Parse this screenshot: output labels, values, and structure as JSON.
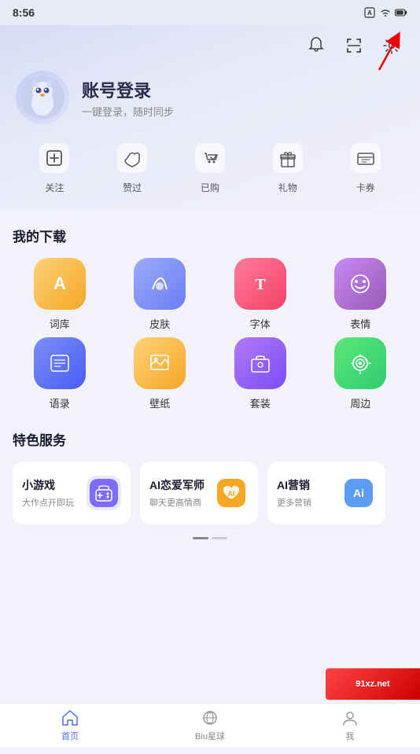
{
  "statusBar": {
    "time": "8:56",
    "icons": [
      "A-icon",
      "wifi-icon",
      "battery-icon"
    ]
  },
  "header": {
    "icons": {
      "bell": "通知",
      "scan": "扫描",
      "settings": "设置"
    },
    "profile": {
      "title": "账号登录",
      "subtitle": "一键登录，随时同步"
    },
    "quickActions": [
      {
        "id": "follow",
        "label": "关注",
        "icon": "plus-circle"
      },
      {
        "id": "liked",
        "label": "赞过",
        "icon": "thumb-up"
      },
      {
        "id": "purchased",
        "label": "已购",
        "icon": "bag-check"
      },
      {
        "id": "gift",
        "label": "礼物",
        "icon": "gift"
      },
      {
        "id": "coupon",
        "label": "卡券",
        "icon": "card"
      }
    ]
  },
  "myDownloads": {
    "title": "我的下载",
    "items": [
      {
        "id": "ciku",
        "label": "词库",
        "bgColor": "#f5a623",
        "iconColor": "#fff"
      },
      {
        "id": "pifu",
        "label": "皮肤",
        "bgColor": "#7b8ff5",
        "iconColor": "#fff"
      },
      {
        "id": "ziti",
        "label": "字体",
        "bgColor": "#f44366",
        "iconColor": "#fff"
      },
      {
        "id": "biaoqing",
        "label": "表情",
        "bgColor": "#9b59b6",
        "iconColor": "#fff"
      },
      {
        "id": "yulu",
        "label": "语录",
        "bgColor": "#5b6cf9",
        "iconColor": "#fff"
      },
      {
        "id": "bizhi",
        "label": "壁纸",
        "bgColor": "#f5a623",
        "iconColor": "#fff"
      },
      {
        "id": "taozhuang",
        "label": "套装",
        "bgColor": "#7b4cf9",
        "iconColor": "#fff"
      },
      {
        "id": "zhoubian",
        "label": "周边",
        "bgColor": "#2ecc71",
        "iconColor": "#fff"
      }
    ]
  },
  "specialServices": {
    "title": "特色服务",
    "items": [
      {
        "id": "xiaoyouxi",
        "title": "小游戏",
        "subtitle": "大作点开即玩",
        "iconBg": "#7b6cf9",
        "iconColor": "#fff"
      },
      {
        "id": "ai-love",
        "title": "AI恋爱军师",
        "subtitle": "聊天更高情商",
        "iconBg": "#f5a623",
        "iconColor": "#fff"
      },
      {
        "id": "ai-marketing",
        "title": "AI营销",
        "subtitle": "更多营销",
        "iconBg": "#5b9cf6",
        "iconColor": "#fff"
      }
    ]
  },
  "bottomNav": {
    "items": [
      {
        "id": "home",
        "label": "首页",
        "active": true
      },
      {
        "id": "biu",
        "label": "Biu星球",
        "active": false
      },
      {
        "id": "me",
        "label": "我",
        "active": false
      }
    ]
  },
  "watermark": {
    "text": "91xz.net"
  }
}
